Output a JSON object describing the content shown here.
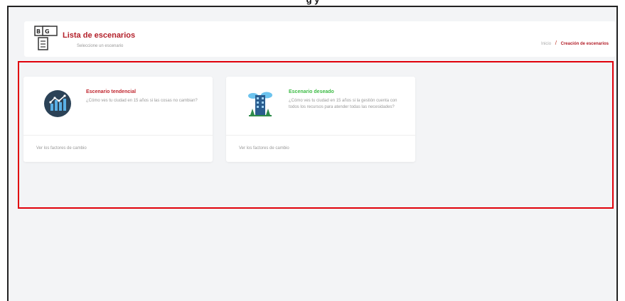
{
  "page": {
    "top_title": "g                                                                    y"
  },
  "header": {
    "title": "Lista de escenarios",
    "subtitle": "Seleccione un escenario",
    "icon": "document-logo-icon"
  },
  "breadcrumb": {
    "home": "Inicio",
    "separator": "/",
    "current": "Creación de escenarios"
  },
  "cards": [
    {
      "title": "Escenario tendencial",
      "description": "¿Cómo ves tu ciudad en 15 años si las cosas no cambian?",
      "link": "Ver los factores de cambio",
      "icon": "trend-chart-icon",
      "title_color": "#c0262f"
    },
    {
      "title": "Escenario deseado",
      "description": "¿Cómo ves tu ciudad en 15 años si la gestión cuenta con todos los recursos para atender todas las necesidades?",
      "link": "Ver los factores de cambio",
      "icon": "city-building-icon",
      "title_color": "#3dbb45"
    }
  ],
  "colors": {
    "accent": "#b3202a",
    "highlight_border": "#e0000a",
    "background": "#f3f4f6"
  }
}
